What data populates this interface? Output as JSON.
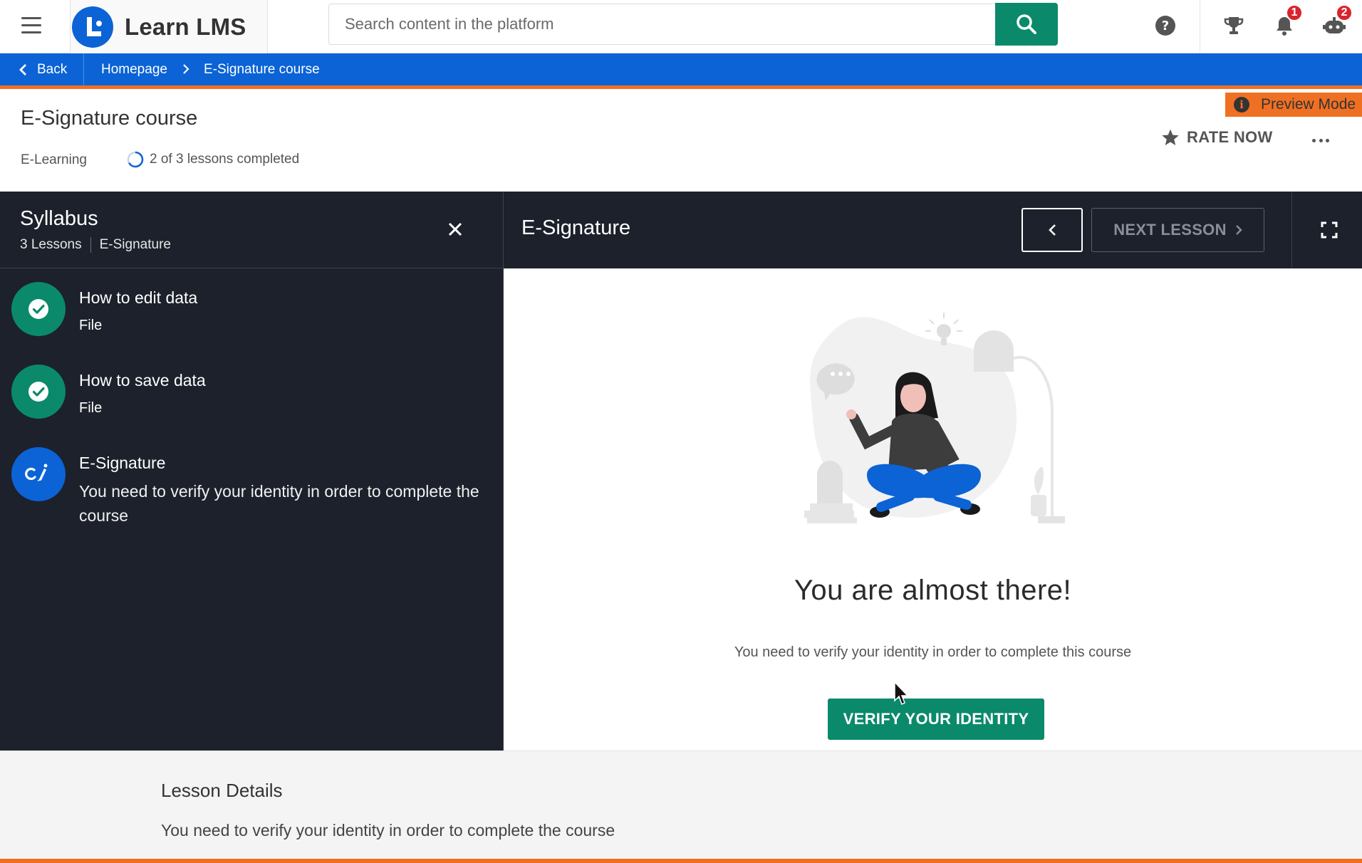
{
  "app": {
    "name": "Learn LMS"
  },
  "search": {
    "placeholder": "Search content in the platform"
  },
  "notifications": {
    "badge": "1"
  },
  "assistant": {
    "badge": "2"
  },
  "breadcrumb": {
    "back": "Back",
    "home": "Homepage",
    "current": "E-Signature course"
  },
  "course": {
    "title": "E-Signature course",
    "type": "E-Learning",
    "progress_text": "2 of 3 lessons completed",
    "progress_fraction": 0.667,
    "preview_mode": "Preview Mode",
    "rate_label": "RATE NOW"
  },
  "syllabus": {
    "title": "Syllabus",
    "lesson_count": "3 Lessons",
    "course_name": "E-Signature",
    "lessons": [
      {
        "title": "How to edit data",
        "subtitle": "File",
        "status": "completed"
      },
      {
        "title": "How to save data",
        "subtitle": "File",
        "status": "completed"
      },
      {
        "title": "E-Signature",
        "subtitle": "You need to verify your identity in order to complete the course",
        "status": "current"
      }
    ]
  },
  "player": {
    "title": "E-Signature",
    "next_label": "NEXT LESSON",
    "heading": "You are almost there!",
    "message": "You need to verify your identity in order to complete this course",
    "verify_label": "VERIFY YOUR IDENTITY"
  },
  "details": {
    "title": "Lesson Details",
    "text": "You need to verify your identity in order to complete the course"
  },
  "colors": {
    "brand_blue": "#0b63d6",
    "green": "#0a8a6a",
    "orange": "#f07023",
    "dark": "#1c212b"
  }
}
